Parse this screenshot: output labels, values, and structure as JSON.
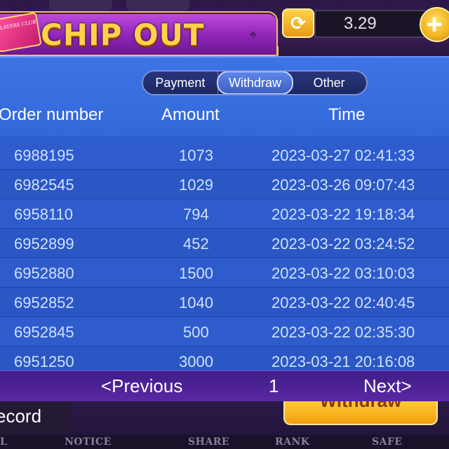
{
  "header": {
    "club_badge": "PLAYERS CLUB",
    "title": "CHIP OUT",
    "balance": "3.29"
  },
  "tabs": [
    {
      "label": "Payment",
      "active": false
    },
    {
      "label": "Withdraw",
      "active": true
    },
    {
      "label": "Other",
      "active": false
    }
  ],
  "table": {
    "columns": [
      "Order number",
      "Amount",
      "Time"
    ],
    "rows": [
      {
        "order": "6988195",
        "amount": "1073",
        "time": "2023-03-27 02:41:33"
      },
      {
        "order": "6982545",
        "amount": "1029",
        "time": "2023-03-26 09:07:43"
      },
      {
        "order": "6958110",
        "amount": "794",
        "time": "2023-03-22 19:18:34"
      },
      {
        "order": "6952899",
        "amount": "452",
        "time": "2023-03-22 03:24:52"
      },
      {
        "order": "6952880",
        "amount": "1500",
        "time": "2023-03-22 03:10:03"
      },
      {
        "order": "6952852",
        "amount": "1040",
        "time": "2023-03-22 02:40:45"
      },
      {
        "order": "6952845",
        "amount": "500",
        "time": "2023-03-22 02:35:30"
      },
      {
        "order": "6951250",
        "amount": "3000",
        "time": "2023-03-21 20:16:08"
      }
    ]
  },
  "pager": {
    "previous": "<Previous",
    "page": "1",
    "next": "Next>"
  },
  "bottom": {
    "record_tab": "ecord",
    "withdraw_button": "Withdraw"
  },
  "nav": [
    "L",
    "NOTICE",
    "SHARE",
    "RANK",
    "SAFE"
  ],
  "icons": {
    "refresh": "refresh-icon",
    "add": "plus-icon",
    "spade": "spade-icon"
  },
  "colors": {
    "title_gold": "#ffd24a",
    "panel_blue": "#2e5ccd",
    "banner_purple": "#a33ccf",
    "button_orange": "#f1a010"
  }
}
